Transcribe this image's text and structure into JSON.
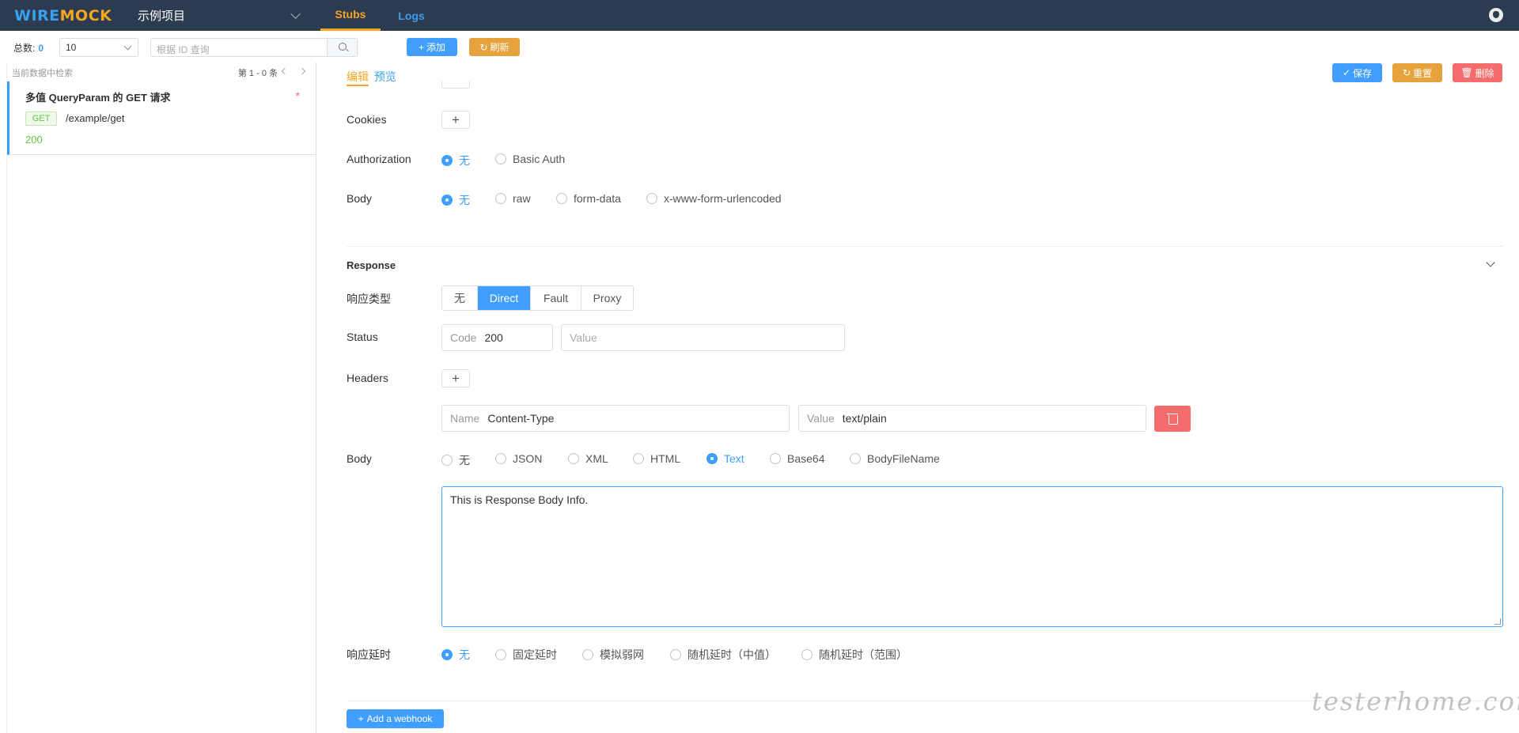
{
  "header": {
    "logo_a": "WIRE",
    "logo_b": "MOCK",
    "project": "示例项目",
    "tabs": [
      {
        "label": "Stubs"
      },
      {
        "label": "Logs"
      }
    ]
  },
  "toolbar": {
    "total_label": "总数:",
    "total_value": "0",
    "page_size": "10",
    "search_placeholder": "根据 ID 查询",
    "add_label": "添加",
    "refresh_label": "刷新"
  },
  "list": {
    "hint": "当前数据中检索",
    "pagination": "第 1 - 0 条",
    "stubs": [
      {
        "title": "多值 QueryParam 的 GET 请求",
        "modified_marker": "*",
        "method": "GET",
        "url": "/example/get",
        "status": "200"
      }
    ]
  },
  "editor": {
    "tabs": {
      "edit": "编辑",
      "preview": "预览"
    },
    "actions": {
      "save": "保存",
      "reset": "重置",
      "delete": "删除"
    },
    "request": {
      "cookies_label": "Cookies",
      "auth_label": "Authorization",
      "auth_options": [
        "无",
        "Basic Auth"
      ],
      "body_label": "Body",
      "body_options": [
        "无",
        "raw",
        "form-data",
        "x-www-form-urlencoded"
      ]
    },
    "response": {
      "section_title": "Response",
      "type_label": "响应类型",
      "type_options": [
        "无",
        "Direct",
        "Fault",
        "Proxy"
      ],
      "status_label": "Status",
      "code_prefix": "Code",
      "code_value": "200",
      "value_placeholder": "Value",
      "headers_label": "Headers",
      "header_name_prefix": "Name",
      "header_name": "Content-Type",
      "header_value_prefix": "Value",
      "header_value": "text/plain",
      "body_label": "Body",
      "body_options": [
        "无",
        "JSON",
        "XML",
        "HTML",
        "Text",
        "Base64",
        "BodyFileName"
      ],
      "body_text": "This is Response Body Info.",
      "delay_label": "响应延时",
      "delay_options": [
        "无",
        "固定延时",
        "模拟弱网",
        "随机延时（中值）",
        "随机延时（范围）"
      ]
    },
    "webhook_label": "Add a webhook"
  },
  "watermark": "testerhome.com"
}
